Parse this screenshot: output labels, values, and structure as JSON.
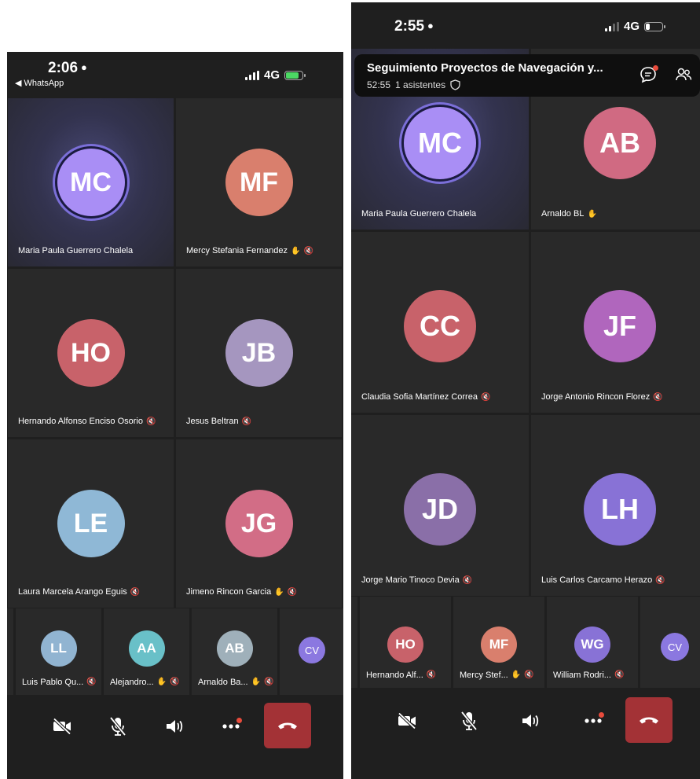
{
  "left": {
    "status": {
      "time": "2:06",
      "back_app": "WhatsApp",
      "network": "4G"
    },
    "tiles": [
      {
        "initials": "MC",
        "name": "Maria Paula Guerrero Chalela",
        "color": "#a98ef5",
        "active": true,
        "muted": false,
        "hand": false
      },
      {
        "initials": "MF",
        "name": "Mercy Stefania Fernandez",
        "color": "#d97f6d",
        "active": false,
        "muted": true,
        "hand": true
      },
      {
        "initials": "HO",
        "name": "Hernando Alfonso Enciso Osorio",
        "color": "#c8626a",
        "active": false,
        "muted": true,
        "hand": false
      },
      {
        "initials": "JB",
        "name": "Jesus Beltran",
        "color": "#a596bf",
        "active": false,
        "muted": true,
        "hand": false
      },
      {
        "initials": "LE",
        "name": "Laura Marcela Arango Eguis",
        "color": "#8fb8d6",
        "active": false,
        "muted": true,
        "hand": false
      },
      {
        "initials": "JG",
        "name": "Jimeno Rincon Garcia",
        "color": "#d26d86",
        "active": false,
        "muted": true,
        "hand": true
      }
    ],
    "strip": [
      {
        "initials": "LL",
        "name": "Luis Pablo Qu...",
        "color": "#91b4d1",
        "muted": true,
        "hand": false
      },
      {
        "initials": "AA",
        "name": "Alejandro...",
        "color": "#69c0c8",
        "muted": true,
        "hand": true
      },
      {
        "initials": "AB",
        "name": "Arnaldo Ba...",
        "color": "#9fb0ba",
        "muted": true,
        "hand": true
      },
      {
        "initials": "CV",
        "name": "",
        "color": "#8b78e0",
        "muted": false,
        "hand": false
      }
    ]
  },
  "right": {
    "status": {
      "time": "2:55",
      "network": "4G"
    },
    "meeting": {
      "title": "Seguimiento Proyectos de Navegación y...",
      "elapsed": "52:55",
      "attendees": "1 asistentes"
    },
    "tiles": [
      {
        "initials": "MC",
        "name": "Maria Paula Guerrero Chalela",
        "color": "#a98ef5",
        "active": true,
        "muted": false,
        "hand": false
      },
      {
        "initials": "AB",
        "name": "Arnaldo BL",
        "color": "#d06a82",
        "active": false,
        "muted": false,
        "hand": true
      },
      {
        "initials": "CC",
        "name": "Claudia Sofia Martínez Correa",
        "color": "#c8626a",
        "active": false,
        "muted": true,
        "hand": false
      },
      {
        "initials": "JF",
        "name": "Jorge Antonio Rincon Florez",
        "color": "#b066bd",
        "active": false,
        "muted": true,
        "hand": false
      },
      {
        "initials": "JD",
        "name": "Jorge Mario Tinoco Devia",
        "color": "#8a6fa8",
        "active": false,
        "muted": true,
        "hand": false
      },
      {
        "initials": "LH",
        "name": "Luis Carlos Carcamo Herazo",
        "color": "#8872d6",
        "active": false,
        "muted": true,
        "hand": false
      }
    ],
    "strip": [
      {
        "initials": "HO",
        "name": "Hernando Alf...",
        "color": "#c8626a",
        "muted": true,
        "hand": false
      },
      {
        "initials": "MF",
        "name": "Mercy Stef...",
        "color": "#d97f6d",
        "muted": true,
        "hand": true
      },
      {
        "initials": "WG",
        "name": "William Rodri...",
        "color": "#8872d6",
        "muted": true,
        "hand": false
      },
      {
        "initials": "CV",
        "name": "",
        "color": "#8b78e0",
        "muted": false,
        "hand": false
      }
    ]
  },
  "icons": {
    "camera_off": "camera-off-icon",
    "mic_off": "mic-off-icon",
    "speaker": "speaker-icon",
    "more": "more-icon",
    "end_call": "end-call-icon",
    "chat": "chat-icon",
    "people": "people-icon"
  },
  "colors": {
    "end_call": "#a33236",
    "notification_dot": "#e84b3c",
    "tile_bg": "#292929"
  }
}
